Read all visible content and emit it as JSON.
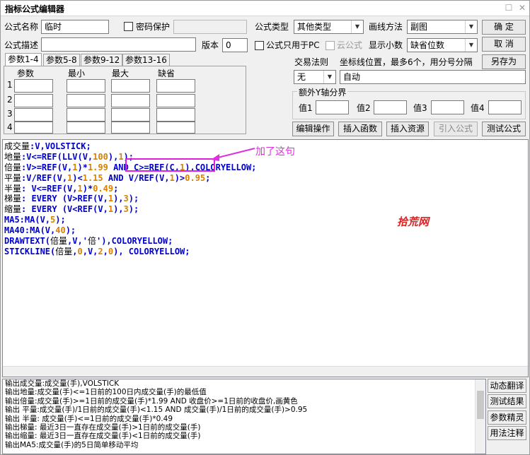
{
  "window": {
    "title": "指标公式编辑器",
    "restore_glyph": "☐",
    "close_glyph": "✕"
  },
  "header": {
    "name_label": "公式名称",
    "name_value": "临时",
    "password_label": "密码保护",
    "desc_label": "公式描述",
    "desc_value": "",
    "version_label": "版本",
    "version_value": "0",
    "type_label": "公式类型",
    "type_value": "其他类型",
    "draw_label": "画线方法",
    "draw_value": "副图",
    "pc_only_label": "公式只用于PC",
    "cloud_label": "云公式",
    "decimals_label": "显示小数",
    "decimals_value": "缺省位数"
  },
  "buttons": {
    "ok": "确  定",
    "cancel": "取  消",
    "save_as": "另存为",
    "edit_ops": "编辑操作",
    "insert_func": "插入函数",
    "insert_res": "插入资源",
    "import_formula": "引入公式",
    "test_formula": "测试公式"
  },
  "tabs": [
    "参数1-4",
    "参数5-8",
    "参数9-12",
    "参数13-16"
  ],
  "params": {
    "headers": [
      "参数",
      "最小",
      "最大",
      "缺省"
    ],
    "rows": [
      "1",
      "2",
      "3",
      "4"
    ]
  },
  "trade": {
    "label": "交易法则",
    "value": "无"
  },
  "coord": {
    "label": "坐标线位置，最多6个，用分号分隔",
    "value": "自动"
  },
  "yaxis": {
    "title": "额外Y轴分界",
    "labels": [
      "值1",
      "值2",
      "值3",
      "值4"
    ]
  },
  "annotation": "加了这句",
  "watermark": "拾荒网",
  "code_lines": [
    [
      {
        "t": "成交量",
        "c": "t"
      },
      {
        "t": ":V,VOLSTICK;",
        "c": "v"
      }
    ],
    [
      {
        "t": "地量",
        "c": "t"
      },
      {
        "t": ":V<=REF(LLV(V,",
        "c": "v"
      },
      {
        "t": "100",
        "c": "n"
      },
      {
        "t": "),",
        "c": "v"
      },
      {
        "t": "1",
        "c": "n"
      },
      {
        "t": ");",
        "c": "v"
      }
    ],
    [
      {
        "t": "倍量",
        "c": "t"
      },
      {
        "t": ":V>=REF(V,",
        "c": "v"
      },
      {
        "t": "1",
        "c": "n"
      },
      {
        "t": ")*",
        "c": "v"
      },
      {
        "t": "1.99",
        "c": "n"
      },
      {
        "t": " AND C>=REF(C,",
        "c": "v"
      },
      {
        "t": "1",
        "c": "n"
      },
      {
        "t": "),COLORYELLOW;",
        "c": "v"
      }
    ],
    [
      {
        "t": "平量",
        "c": "t"
      },
      {
        "t": ":V/REF(V,",
        "c": "v"
      },
      {
        "t": "1",
        "c": "n"
      },
      {
        "t": ")<",
        "c": "v"
      },
      {
        "t": "1.15",
        "c": "n"
      },
      {
        "t": " AND V/REF(V,",
        "c": "v"
      },
      {
        "t": "1",
        "c": "n"
      },
      {
        "t": ")>",
        "c": "v"
      },
      {
        "t": "0.95",
        "c": "n"
      },
      {
        "t": ";",
        "c": "v"
      }
    ],
    [
      {
        "t": "半量",
        "c": "t"
      },
      {
        "t": ": V<=REF(V,",
        "c": "v"
      },
      {
        "t": "1",
        "c": "n"
      },
      {
        "t": ")*",
        "c": "v"
      },
      {
        "t": "0.49",
        "c": "n"
      },
      {
        "t": ";",
        "c": "v"
      }
    ],
    [
      {
        "t": "梯量",
        "c": "t"
      },
      {
        "t": ": EVERY (V>REF(V,",
        "c": "v"
      },
      {
        "t": "1",
        "c": "n"
      },
      {
        "t": "),",
        "c": "v"
      },
      {
        "t": "3",
        "c": "n"
      },
      {
        "t": ");",
        "c": "v"
      }
    ],
    [
      {
        "t": "缩量",
        "c": "t"
      },
      {
        "t": ": EVERY (V<REF(V,",
        "c": "v"
      },
      {
        "t": "1",
        "c": "n"
      },
      {
        "t": "),",
        "c": "v"
      },
      {
        "t": "3",
        "c": "n"
      },
      {
        "t": ");",
        "c": "v"
      }
    ],
    [
      {
        "t": "MA5:MA(V,",
        "c": "v"
      },
      {
        "t": "5",
        "c": "n"
      },
      {
        "t": ");",
        "c": "v"
      }
    ],
    [
      {
        "t": "MA40:MA(V,",
        "c": "v"
      },
      {
        "t": "40",
        "c": "n"
      },
      {
        "t": ");",
        "c": "v"
      }
    ],
    [
      {
        "t": "DRAWTEXT(",
        "c": "v"
      },
      {
        "t": "倍量",
        "c": "t"
      },
      {
        "t": ",V,'",
        "c": "v"
      },
      {
        "t": "倍",
        "c": "t"
      },
      {
        "t": "'),COLORYELLOW;",
        "c": "v"
      }
    ],
    [
      {
        "t": "STICKLINE(",
        "c": "v"
      },
      {
        "t": "倍量",
        "c": "t"
      },
      {
        "t": ",",
        "c": "v"
      },
      {
        "t": "0",
        "c": "n"
      },
      {
        "t": ",V,",
        "c": "v"
      },
      {
        "t": "2",
        "c": "n"
      },
      {
        "t": ",",
        "c": "v"
      },
      {
        "t": "0",
        "c": "n"
      },
      {
        "t": "), COLORYELLOW;",
        "c": "v"
      }
    ]
  ],
  "output_lines": [
    "输出成交量:成交量(手),VOLSTICK",
    "输出地量:成交量(手)<=1日前的100日内成交量(手)的最低值",
    "输出倍量:成交量(手)>=1日前的成交量(手)*1.99 AND 收盘价>=1日前的收盘价,画黄色",
    "输出 平量:成交量(手)/1日前的成交量(手)<1.15 AND 成交量(手)/1日前的成交量(手)>0.95",
    "输出 半量: 成交量(手)<=1日前的成交量(手)*0.49",
    "输出梯量: 最近3日一直存在成交量(手)>1日前的成交量(手)",
    "输出缩量: 最近3日一直存在成交量(手)<1日前的成交量(手)",
    "输出MA5:成交量(手)的5日简单移动平均"
  ],
  "side_buttons": [
    "动态翻译",
    "测试结果",
    "参数精灵",
    "用法注释"
  ]
}
